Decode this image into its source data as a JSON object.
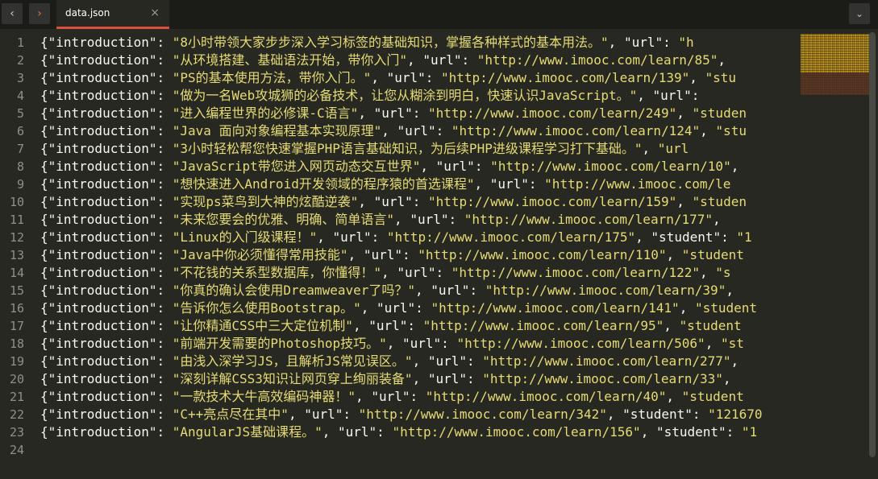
{
  "tabbar": {
    "prev_icon": "‹",
    "next_icon": "›",
    "dropdown_icon": "⌄"
  },
  "tab": {
    "title": "data.json",
    "close_icon": "×"
  },
  "icons": {
    "prev": "chevron-left-icon",
    "next": "chevron-right-icon",
    "close": "close-icon",
    "dropdown": "chevron-down-icon"
  },
  "colors": {
    "background": "#272822",
    "string": "#e6db74",
    "text": "#f8f8f2",
    "line_number": "#8f908a",
    "tab_accent": "#d8503c"
  },
  "editor": {
    "lines": [
      {
        "num": "1",
        "pre": "{\"introduction\": ",
        "str": "\"8小时带领大家步步深入学习标签的基础知识，掌握各种样式的基本用法。\"",
        "post": ", \"url\": \"h"
      },
      {
        "num": "2",
        "pre": "{\"introduction\": ",
        "str": "\"从环境搭建、基础语法开始，带你入门\"",
        "post": ", \"url\": \"http://www.imooc.com/learn/85\","
      },
      {
        "num": "3",
        "pre": "{\"introduction\": ",
        "str": "\"PS的基本使用方法，带你入门。\"",
        "post": ", \"url\": \"http://www.imooc.com/learn/139\", \"stu"
      },
      {
        "num": "4",
        "pre": "{\"introduction\": ",
        "str": "\"做为一名Web攻城狮的必备技术，让您从糊涂到明白，快速认识JavaScript。\"",
        "post": ", \"url\":"
      },
      {
        "num": "5",
        "pre": "{\"introduction\": ",
        "str": "\"进入编程世界的必修课-C语言\"",
        "post": ", \"url\": \"http://www.imooc.com/learn/249\", \"studen"
      },
      {
        "num": "6",
        "pre": "{\"introduction\": ",
        "str": "\"Java 面向对象编程基本实现原理\"",
        "post": ", \"url\": \"http://www.imooc.com/learn/124\", \"stu"
      },
      {
        "num": "7",
        "pre": "{\"introduction\": ",
        "str": "\"3小时轻松帮您快速掌握PHP语言基础知识，为后续PHP进级课程学习打下基础。\"",
        "post": ", \"url"
      },
      {
        "num": "8",
        "pre": "{\"introduction\": ",
        "str": "\"JavaScript带您进入网页动态交互世界\"",
        "post": ", \"url\": \"http://www.imooc.com/learn/10\","
      },
      {
        "num": "9",
        "pre": "{\"introduction\": ",
        "str": "\"想快速进入Android开发领域的程序猿的首选课程\"",
        "post": ", \"url\": \"http://www.imooc.com/le"
      },
      {
        "num": "10",
        "pre": "{\"introduction\": ",
        "str": "\"实现ps菜鸟到大神的炫酷逆袭\"",
        "post": ", \"url\": \"http://www.imooc.com/learn/159\", \"studen"
      },
      {
        "num": "11",
        "pre": "{\"introduction\": ",
        "str": "\"未来您要会的优雅、明确、简单语言\"",
        "post": ", \"url\": \"http://www.imooc.com/learn/177\","
      },
      {
        "num": "12",
        "pre": "{\"introduction\": ",
        "str": "\"Linux的入门级课程！\"",
        "post": ", \"url\": \"http://www.imooc.com/learn/175\", \"student\": \"1"
      },
      {
        "num": "13",
        "pre": "{\"introduction\": ",
        "str": "\"Java中你必须懂得常用技能\"",
        "post": ", \"url\": \"http://www.imooc.com/learn/110\", \"student"
      },
      {
        "num": "14",
        "pre": "{\"introduction\": ",
        "str": "\"不花钱的关系型数据库，你懂得！\"",
        "post": ", \"url\": \"http://www.imooc.com/learn/122\", \"s"
      },
      {
        "num": "15",
        "pre": "{\"introduction\": ",
        "str": "\"你真的确认会使用Dreamweaver了吗？\"",
        "post": ", \"url\": \"http://www.imooc.com/learn/39\","
      },
      {
        "num": "16",
        "pre": "{\"introduction\": ",
        "str": "\"告诉你怎么使用Bootstrap。\"",
        "post": ", \"url\": \"http://www.imooc.com/learn/141\", \"student"
      },
      {
        "num": "17",
        "pre": "{\"introduction\": ",
        "str": "\"让你精通CSS中三大定位机制\"",
        "post": ", \"url\": \"http://www.imooc.com/learn/95\", \"student"
      },
      {
        "num": "18",
        "pre": "{\"introduction\": ",
        "str": "\"前端开发需要的Photoshop技巧。\"",
        "post": ", \"url\": \"http://www.imooc.com/learn/506\", \"st"
      },
      {
        "num": "19",
        "pre": "{\"introduction\": ",
        "str": "\"由浅入深学习JS，且解析JS常见误区。\"",
        "post": ", \"url\": \"http://www.imooc.com/learn/277\","
      },
      {
        "num": "20",
        "pre": "{\"introduction\": ",
        "str": "\"深刻详解CSS3知识让网页穿上绚丽装备\"",
        "post": ", \"url\": \"http://www.imooc.com/learn/33\","
      },
      {
        "num": "21",
        "pre": "{\"introduction\": ",
        "str": "\"一款技术大牛高效编码神器！\"",
        "post": ", \"url\": \"http://www.imooc.com/learn/40\", \"student"
      },
      {
        "num": "22",
        "pre": "{\"introduction\": ",
        "str": "\"C++亮点尽在其中\"",
        "post": ", \"url\": \"http://www.imooc.com/learn/342\", \"student\": \"121670"
      },
      {
        "num": "23",
        "pre": "{\"introduction\": ",
        "str": "\"AngularJS基础课程。\"",
        "post": ", \"url\": \"http://www.imooc.com/learn/156\", \"student\": \"1"
      },
      {
        "num": "24",
        "pre": "",
        "str": "",
        "post": ""
      }
    ]
  }
}
